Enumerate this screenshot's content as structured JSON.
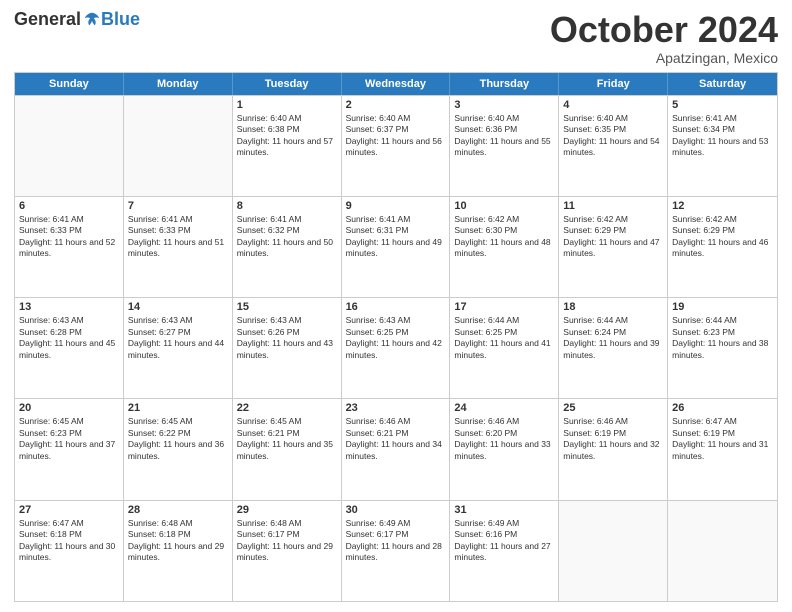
{
  "logo": {
    "general": "General",
    "blue": "Blue"
  },
  "title": "October 2024",
  "subtitle": "Apatzingan, Mexico",
  "header_days": [
    "Sunday",
    "Monday",
    "Tuesday",
    "Wednesday",
    "Thursday",
    "Friday",
    "Saturday"
  ],
  "weeks": [
    [
      {
        "day": "",
        "sunrise": "",
        "sunset": "",
        "daylight": ""
      },
      {
        "day": "",
        "sunrise": "",
        "sunset": "",
        "daylight": ""
      },
      {
        "day": "1",
        "sunrise": "Sunrise: 6:40 AM",
        "sunset": "Sunset: 6:38 PM",
        "daylight": "Daylight: 11 hours and 57 minutes."
      },
      {
        "day": "2",
        "sunrise": "Sunrise: 6:40 AM",
        "sunset": "Sunset: 6:37 PM",
        "daylight": "Daylight: 11 hours and 56 minutes."
      },
      {
        "day": "3",
        "sunrise": "Sunrise: 6:40 AM",
        "sunset": "Sunset: 6:36 PM",
        "daylight": "Daylight: 11 hours and 55 minutes."
      },
      {
        "day": "4",
        "sunrise": "Sunrise: 6:40 AM",
        "sunset": "Sunset: 6:35 PM",
        "daylight": "Daylight: 11 hours and 54 minutes."
      },
      {
        "day": "5",
        "sunrise": "Sunrise: 6:41 AM",
        "sunset": "Sunset: 6:34 PM",
        "daylight": "Daylight: 11 hours and 53 minutes."
      }
    ],
    [
      {
        "day": "6",
        "sunrise": "Sunrise: 6:41 AM",
        "sunset": "Sunset: 6:33 PM",
        "daylight": "Daylight: 11 hours and 52 minutes."
      },
      {
        "day": "7",
        "sunrise": "Sunrise: 6:41 AM",
        "sunset": "Sunset: 6:33 PM",
        "daylight": "Daylight: 11 hours and 51 minutes."
      },
      {
        "day": "8",
        "sunrise": "Sunrise: 6:41 AM",
        "sunset": "Sunset: 6:32 PM",
        "daylight": "Daylight: 11 hours and 50 minutes."
      },
      {
        "day": "9",
        "sunrise": "Sunrise: 6:41 AM",
        "sunset": "Sunset: 6:31 PM",
        "daylight": "Daylight: 11 hours and 49 minutes."
      },
      {
        "day": "10",
        "sunrise": "Sunrise: 6:42 AM",
        "sunset": "Sunset: 6:30 PM",
        "daylight": "Daylight: 11 hours and 48 minutes."
      },
      {
        "day": "11",
        "sunrise": "Sunrise: 6:42 AM",
        "sunset": "Sunset: 6:29 PM",
        "daylight": "Daylight: 11 hours and 47 minutes."
      },
      {
        "day": "12",
        "sunrise": "Sunrise: 6:42 AM",
        "sunset": "Sunset: 6:29 PM",
        "daylight": "Daylight: 11 hours and 46 minutes."
      }
    ],
    [
      {
        "day": "13",
        "sunrise": "Sunrise: 6:43 AM",
        "sunset": "Sunset: 6:28 PM",
        "daylight": "Daylight: 11 hours and 45 minutes."
      },
      {
        "day": "14",
        "sunrise": "Sunrise: 6:43 AM",
        "sunset": "Sunset: 6:27 PM",
        "daylight": "Daylight: 11 hours and 44 minutes."
      },
      {
        "day": "15",
        "sunrise": "Sunrise: 6:43 AM",
        "sunset": "Sunset: 6:26 PM",
        "daylight": "Daylight: 11 hours and 43 minutes."
      },
      {
        "day": "16",
        "sunrise": "Sunrise: 6:43 AM",
        "sunset": "Sunset: 6:25 PM",
        "daylight": "Daylight: 11 hours and 42 minutes."
      },
      {
        "day": "17",
        "sunrise": "Sunrise: 6:44 AM",
        "sunset": "Sunset: 6:25 PM",
        "daylight": "Daylight: 11 hours and 41 minutes."
      },
      {
        "day": "18",
        "sunrise": "Sunrise: 6:44 AM",
        "sunset": "Sunset: 6:24 PM",
        "daylight": "Daylight: 11 hours and 39 minutes."
      },
      {
        "day": "19",
        "sunrise": "Sunrise: 6:44 AM",
        "sunset": "Sunset: 6:23 PM",
        "daylight": "Daylight: 11 hours and 38 minutes."
      }
    ],
    [
      {
        "day": "20",
        "sunrise": "Sunrise: 6:45 AM",
        "sunset": "Sunset: 6:23 PM",
        "daylight": "Daylight: 11 hours and 37 minutes."
      },
      {
        "day": "21",
        "sunrise": "Sunrise: 6:45 AM",
        "sunset": "Sunset: 6:22 PM",
        "daylight": "Daylight: 11 hours and 36 minutes."
      },
      {
        "day": "22",
        "sunrise": "Sunrise: 6:45 AM",
        "sunset": "Sunset: 6:21 PM",
        "daylight": "Daylight: 11 hours and 35 minutes."
      },
      {
        "day": "23",
        "sunrise": "Sunrise: 6:46 AM",
        "sunset": "Sunset: 6:21 PM",
        "daylight": "Daylight: 11 hours and 34 minutes."
      },
      {
        "day": "24",
        "sunrise": "Sunrise: 6:46 AM",
        "sunset": "Sunset: 6:20 PM",
        "daylight": "Daylight: 11 hours and 33 minutes."
      },
      {
        "day": "25",
        "sunrise": "Sunrise: 6:46 AM",
        "sunset": "Sunset: 6:19 PM",
        "daylight": "Daylight: 11 hours and 32 minutes."
      },
      {
        "day": "26",
        "sunrise": "Sunrise: 6:47 AM",
        "sunset": "Sunset: 6:19 PM",
        "daylight": "Daylight: 11 hours and 31 minutes."
      }
    ],
    [
      {
        "day": "27",
        "sunrise": "Sunrise: 6:47 AM",
        "sunset": "Sunset: 6:18 PM",
        "daylight": "Daylight: 11 hours and 30 minutes."
      },
      {
        "day": "28",
        "sunrise": "Sunrise: 6:48 AM",
        "sunset": "Sunset: 6:18 PM",
        "daylight": "Daylight: 11 hours and 29 minutes."
      },
      {
        "day": "29",
        "sunrise": "Sunrise: 6:48 AM",
        "sunset": "Sunset: 6:17 PM",
        "daylight": "Daylight: 11 hours and 29 minutes."
      },
      {
        "day": "30",
        "sunrise": "Sunrise: 6:49 AM",
        "sunset": "Sunset: 6:17 PM",
        "daylight": "Daylight: 11 hours and 28 minutes."
      },
      {
        "day": "31",
        "sunrise": "Sunrise: 6:49 AM",
        "sunset": "Sunset: 6:16 PM",
        "daylight": "Daylight: 11 hours and 27 minutes."
      },
      {
        "day": "",
        "sunrise": "",
        "sunset": "",
        "daylight": ""
      },
      {
        "day": "",
        "sunrise": "",
        "sunset": "",
        "daylight": ""
      }
    ]
  ]
}
